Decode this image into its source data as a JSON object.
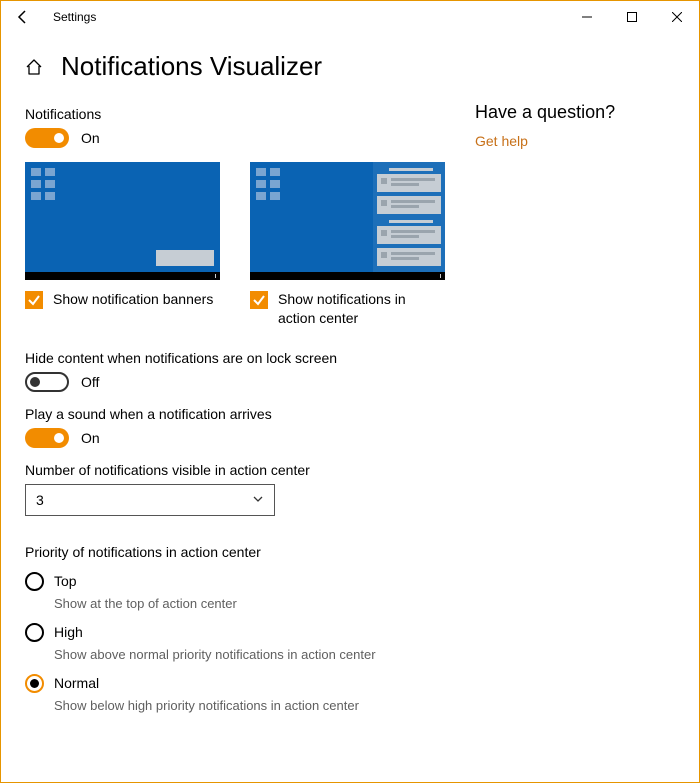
{
  "window": {
    "title": "Settings"
  },
  "header": {
    "page_title": "Notifications Visualizer"
  },
  "notifications": {
    "label": "Notifications",
    "toggle_state": "On",
    "banners_label": "Show notification banners",
    "action_center_label": "Show notifications in action center"
  },
  "lock_screen": {
    "label": "Hide content when notifications are on lock screen",
    "toggle_state": "Off"
  },
  "sound": {
    "label": "Play a sound when a notification arrives",
    "toggle_state": "On"
  },
  "number_visible": {
    "label": "Number of notifications visible in action center",
    "value": "3"
  },
  "priority": {
    "label": "Priority of notifications in action center",
    "options": [
      {
        "name": "Top",
        "desc": "Show at the top of action center",
        "selected": false
      },
      {
        "name": "High",
        "desc": "Show above normal priority notifications in action center",
        "selected": false
      },
      {
        "name": "Normal",
        "desc": "Show below high priority notifications in action center",
        "selected": true
      }
    ]
  },
  "help": {
    "heading": "Have a question?",
    "link": "Get help"
  }
}
